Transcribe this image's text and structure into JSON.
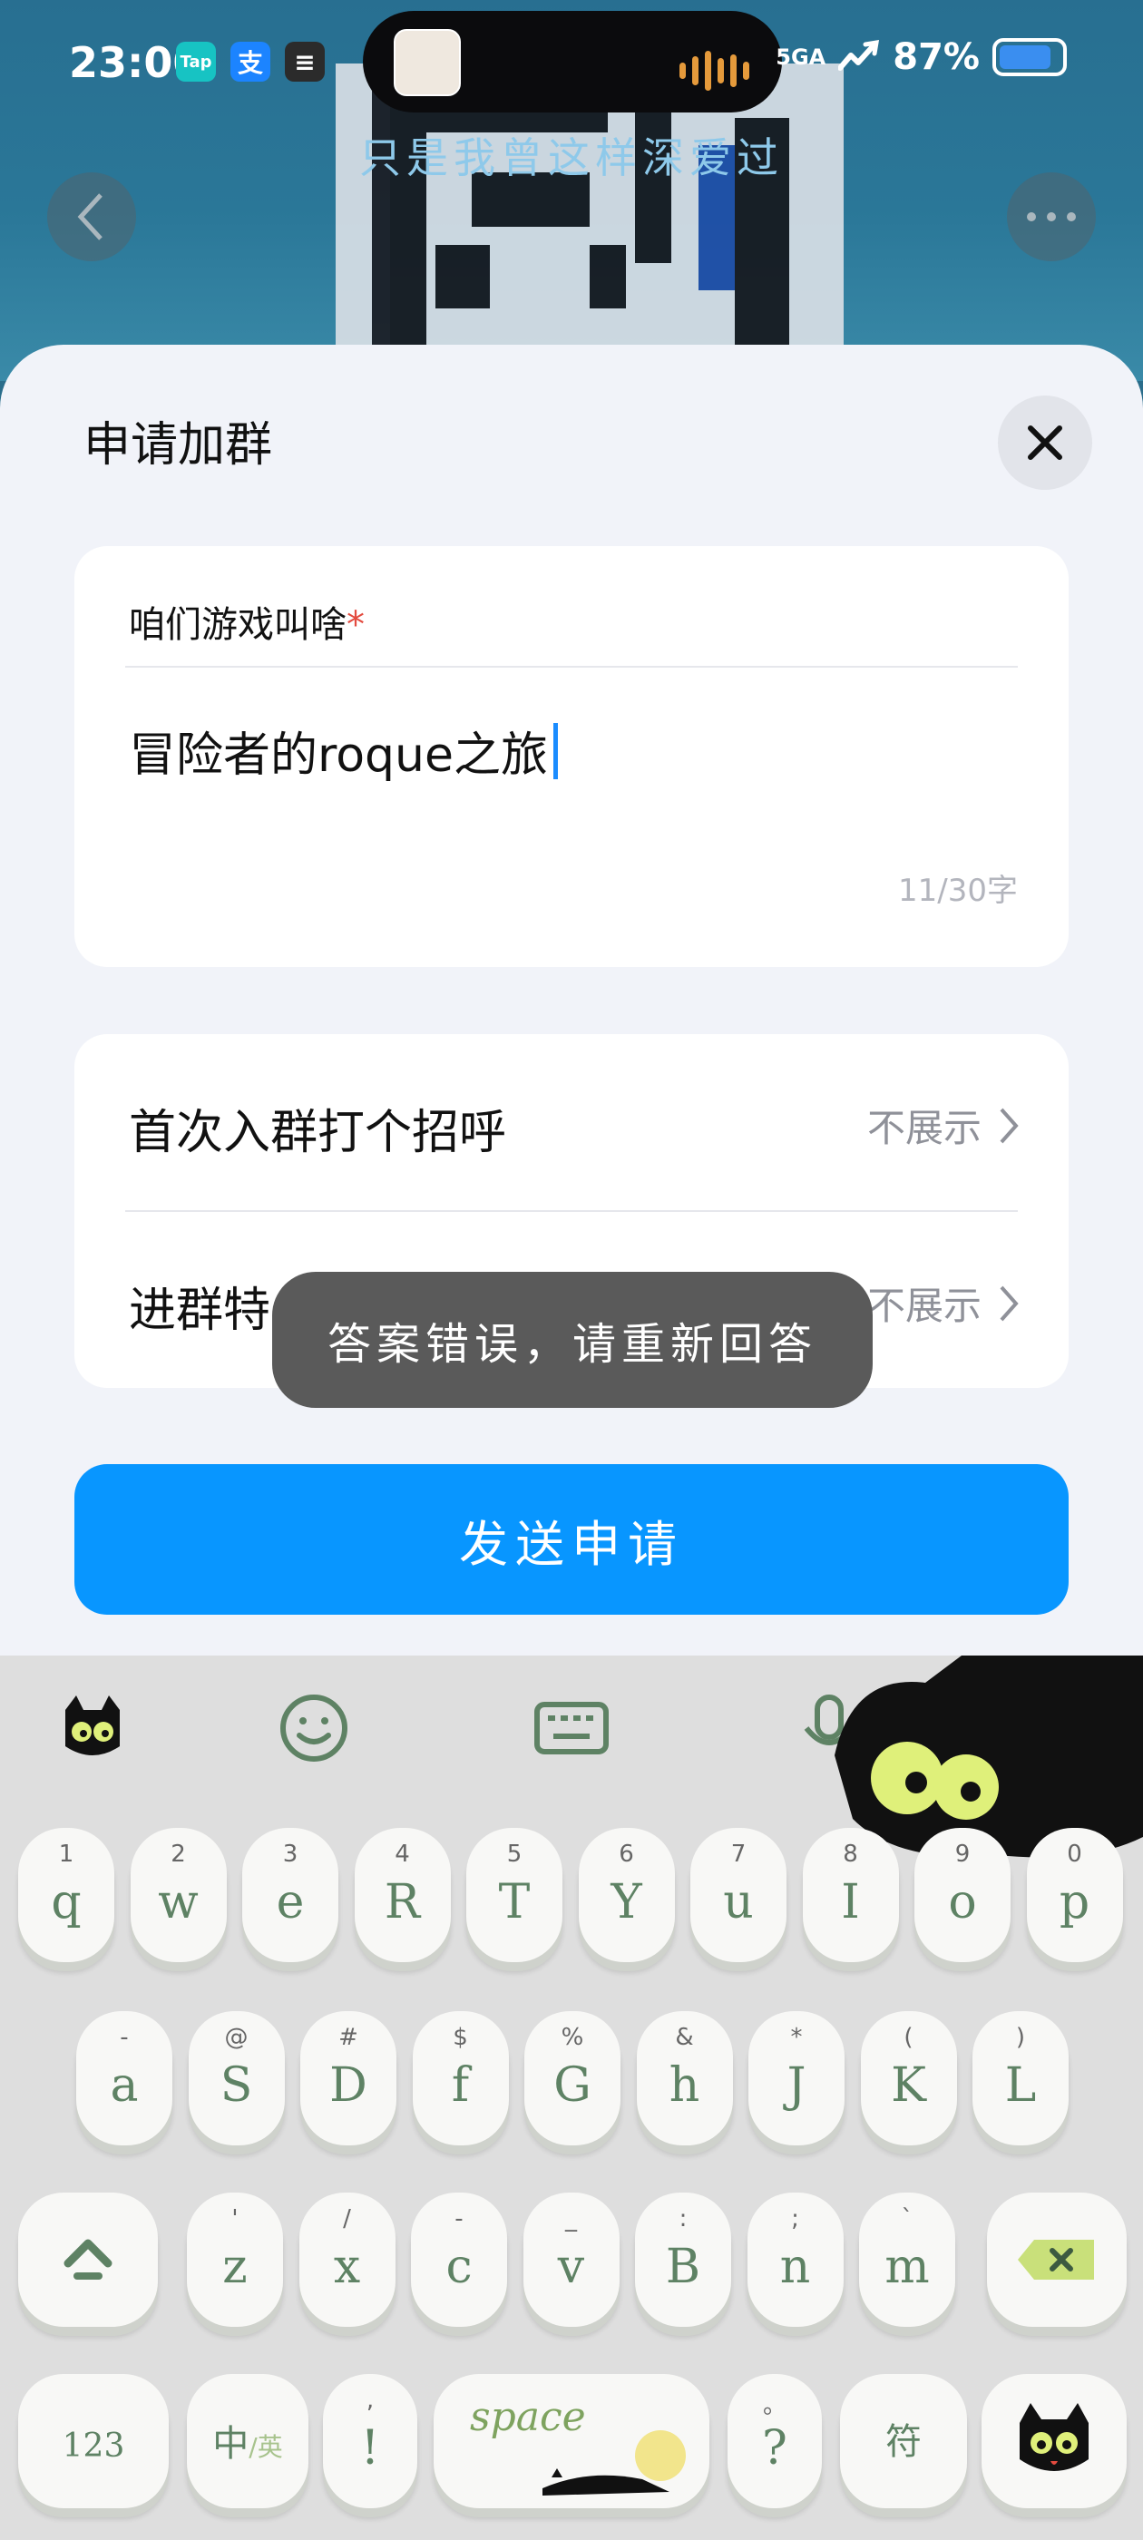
{
  "status_bar": {
    "time": "23:00",
    "apps": [
      {
        "label": "Tap",
        "color": "#17c3c3"
      },
      {
        "label": "支",
        "color": "#1c84ff"
      },
      {
        "label": "≡",
        "color": "#2b2b2b"
      }
    ],
    "network": "5GA",
    "battery_percent": "87%",
    "battery_level": 0.87
  },
  "background": {
    "group_title": "只是我曾这样深爱过",
    "back_icon": "chevron-left-icon",
    "more_icon": "more-horizontal-icon"
  },
  "sheet": {
    "title": "申请加群",
    "close_icon": "close-icon",
    "question": {
      "label": "咱们游戏叫啥",
      "required_mark": "*",
      "answer": "冒险者的roque之旅",
      "counter": "11/30字"
    },
    "options": [
      {
        "label": "首次入群打个招呼",
        "value": "不展示",
        "icon": "chevron-right-icon"
      },
      {
        "label": "进群特",
        "value": "不展示",
        "icon": "chevron-right-icon"
      }
    ],
    "submit_label": "发送申请"
  },
  "toast": {
    "text": "答案错误，请重新回答"
  },
  "keyboard": {
    "toolbar": [
      "cat-logo-icon",
      "emoji-icon",
      "keyboard-icon",
      "microphone-icon",
      "collapse-icon"
    ],
    "row1": [
      {
        "sub": "1",
        "main": "q"
      },
      {
        "sub": "2",
        "main": "w"
      },
      {
        "sub": "3",
        "main": "e"
      },
      {
        "sub": "4",
        "main": "R"
      },
      {
        "sub": "5",
        "main": "T"
      },
      {
        "sub": "6",
        "main": "Y"
      },
      {
        "sub": "7",
        "main": "u"
      },
      {
        "sub": "8",
        "main": "I"
      },
      {
        "sub": "9",
        "main": "o"
      },
      {
        "sub": "0",
        "main": "p"
      }
    ],
    "row2": [
      {
        "sub": "-",
        "main": "a"
      },
      {
        "sub": "@",
        "main": "S"
      },
      {
        "sub": "#",
        "main": "D"
      },
      {
        "sub": "$",
        "main": "f"
      },
      {
        "sub": "%",
        "main": "G"
      },
      {
        "sub": "&",
        "main": "h"
      },
      {
        "sub": "*",
        "main": "J"
      },
      {
        "sub": "(",
        "main": "K"
      },
      {
        "sub": ")",
        "main": "L"
      }
    ],
    "row3": [
      {
        "sub": "'",
        "main": "z"
      },
      {
        "sub": "/",
        "main": "x"
      },
      {
        "sub": "-",
        "main": "c"
      },
      {
        "sub": "_",
        "main": "v"
      },
      {
        "sub": ":",
        "main": "B"
      },
      {
        "sub": ";",
        "main": "n"
      },
      {
        "sub": "`",
        "main": "m"
      }
    ],
    "bottom": {
      "num_label": "123",
      "lang_main": "中",
      "lang_sub": "/英",
      "punct_main": "!",
      "punct_sub": ",",
      "space_label": "space",
      "question_main": "?",
      "question_sub": "。",
      "symbol_label": "符"
    }
  }
}
